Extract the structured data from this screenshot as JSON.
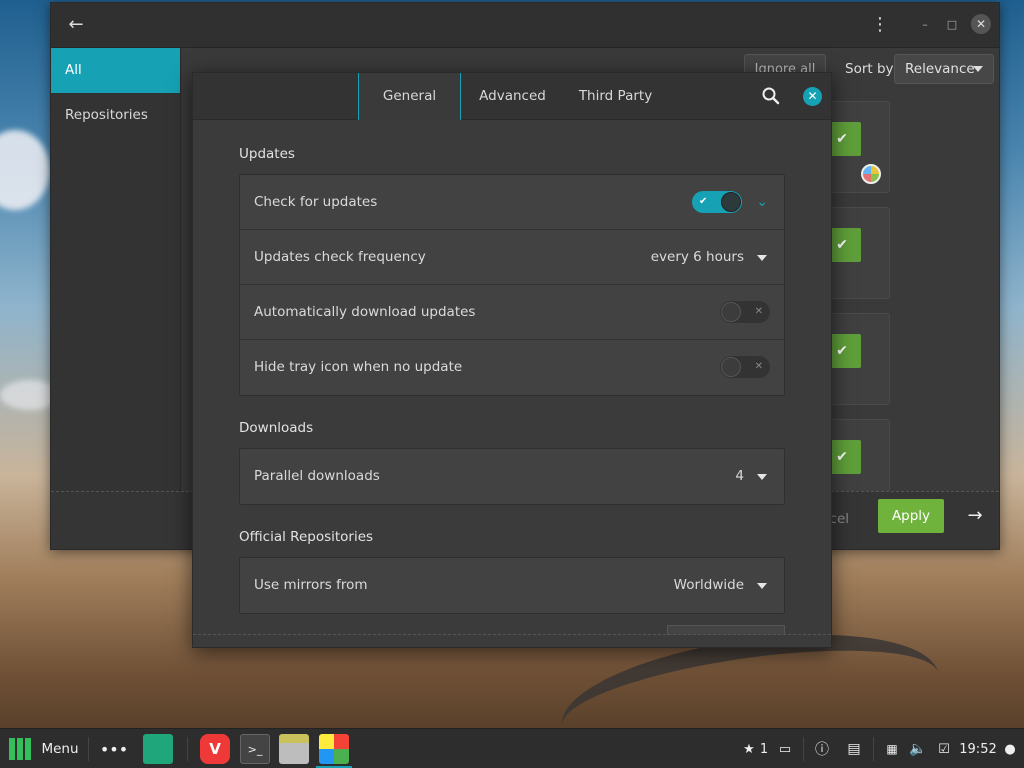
{
  "main_window": {
    "sidebar": [
      "All",
      "Repositories"
    ],
    "ignore_button": "Ignore all",
    "sort_label": "Sort by",
    "sort_value": "Relevance",
    "cancel_button": "ncel",
    "apply_button": "Apply"
  },
  "dialog": {
    "tabs": [
      "General",
      "Advanced",
      "Third Party"
    ],
    "active_tab": "General",
    "sections": {
      "updates": {
        "title": "Updates",
        "check_for_updates": {
          "label": "Check for updates",
          "enabled": true
        },
        "frequency": {
          "label": "Updates check frequency",
          "value": "every 6 hours"
        },
        "auto_download": {
          "label": "Automatically download updates",
          "enabled": false
        },
        "hide_tray": {
          "label": "Hide tray icon when no update",
          "enabled": false
        }
      },
      "downloads": {
        "title": "Downloads",
        "parallel": {
          "label": "Parallel downloads",
          "value": "4"
        }
      },
      "official_repositories": {
        "title": "Official Repositories",
        "mirrors": {
          "label": "Use mirrors from",
          "value": "Worldwide"
        }
      }
    }
  },
  "taskbar": {
    "menu_label": "Menu",
    "notification_count": "1",
    "clock": "19:52"
  },
  "icons": {
    "back": "arrow-left-icon",
    "kebab": "kebab-menu-icon",
    "minimize": "minimize-icon",
    "maximize": "maximize-icon",
    "close": "close-icon",
    "search": "search-icon",
    "check": "check-icon",
    "next": "arrow-right-icon"
  },
  "colors": {
    "accent": "#16a2b4",
    "apply_green": "#6fb33d",
    "installed_green": "#5f9f3a"
  }
}
